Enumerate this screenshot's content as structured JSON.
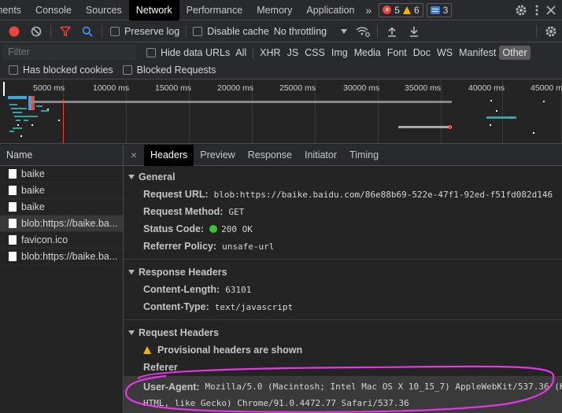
{
  "tabs": [
    {
      "label": "ments",
      "active": false
    },
    {
      "label": "Console",
      "active": false
    },
    {
      "label": "Sources",
      "active": false
    },
    {
      "label": "Network",
      "active": true
    },
    {
      "label": "Performance",
      "active": false
    },
    {
      "label": "Memory",
      "active": false
    },
    {
      "label": "Application",
      "active": false
    }
  ],
  "counts": {
    "errors": "5",
    "warnings": "6",
    "messages": "3"
  },
  "toolbar": {
    "preserve_log": "Preserve log",
    "disable_cache": "Disable cache",
    "throttling": "No throttling"
  },
  "filter": {
    "placeholder": "Filter",
    "hide_data_urls": "Hide data URLs",
    "types": [
      "All",
      "XHR",
      "JS",
      "CSS",
      "Img",
      "Media",
      "Font",
      "Doc",
      "WS",
      "Manifest",
      "Other"
    ],
    "selected_type": "Other",
    "has_blocked_cookies": "Has blocked cookies",
    "blocked_requests": "Blocked Requests"
  },
  "timeline": {
    "ticks": [
      "5000 ms",
      "10000 ms",
      "15000 ms",
      "20000 ms",
      "25000 ms",
      "30000 ms",
      "35000 ms",
      "40000 ms",
      "45000 ms"
    ]
  },
  "requests": {
    "header": "Name",
    "items": [
      {
        "name": "baike",
        "selected": false
      },
      {
        "name": "baike",
        "selected": false
      },
      {
        "name": "baike",
        "selected": false
      },
      {
        "name": "blob:https://baike.ba...",
        "selected": true
      },
      {
        "name": "favicon.ico",
        "selected": false
      },
      {
        "name": "blob:https://baike.ba...",
        "selected": false
      }
    ]
  },
  "details": {
    "tabs": [
      "Headers",
      "Preview",
      "Response",
      "Initiator",
      "Timing"
    ],
    "active_tab": "Headers",
    "general": {
      "title": "General",
      "request_url_label": "Request URL:",
      "request_url": "blob:https://baike.baidu.com/86e88b69-522e-47f1-92ed-f51fd082d146",
      "request_method_label": "Request Method:",
      "request_method": "GET",
      "status_code_label": "Status Code:",
      "status_code": "200 OK",
      "referrer_policy_label": "Referrer Policy:",
      "referrer_policy": "unsafe-url"
    },
    "response_headers": {
      "title": "Response Headers",
      "content_length_label": "Content-Length:",
      "content_length": "63101",
      "content_type_label": "Content-Type:",
      "content_type": "text/javascript"
    },
    "request_headers": {
      "title": "Request Headers",
      "provisional": "Provisional headers are shown",
      "referer_label": "Referer",
      "user_agent_label": "User-Agent:",
      "user_agent_line1": "Mozilla/5.0 (Macintosh; Intel Mac OS X 10_15_7) AppleWebKit/537.36 (K",
      "user_agent_line2": "HTML, like Gecko) Chrome/91.0.4472.77 Safari/537.36"
    }
  },
  "colors": {
    "accent": "#e438e4",
    "record": "#e8453c",
    "filter": "#e8453c",
    "search": "#4a8ff0"
  }
}
